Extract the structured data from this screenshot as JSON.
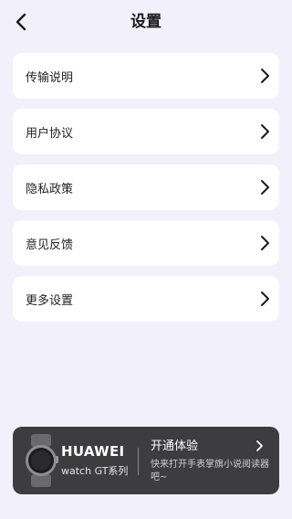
{
  "header": {
    "title": "设置",
    "back_icon": "chevron-left-icon"
  },
  "menu": {
    "items": [
      {
        "label": "传输说明",
        "icon": "chevron-right-icon"
      },
      {
        "label": "用户协议",
        "icon": "chevron-right-icon"
      },
      {
        "label": "隐私政策",
        "icon": "chevron-right-icon"
      },
      {
        "label": "意见反馈",
        "icon": "chevron-right-icon"
      },
      {
        "label": "更多设置",
        "icon": "chevron-right-icon"
      }
    ]
  },
  "banner": {
    "brand": "HUAWEI",
    "series": "watch GT系列",
    "cta_title": "开通体验",
    "cta_desc": "快来打开手表掌旗小说阅读器吧~",
    "icon": "smartwatch-icon",
    "background": "#3d3d3f"
  },
  "colors": {
    "page_background": "#f2f0fb",
    "card_background": "#ffffff"
  }
}
